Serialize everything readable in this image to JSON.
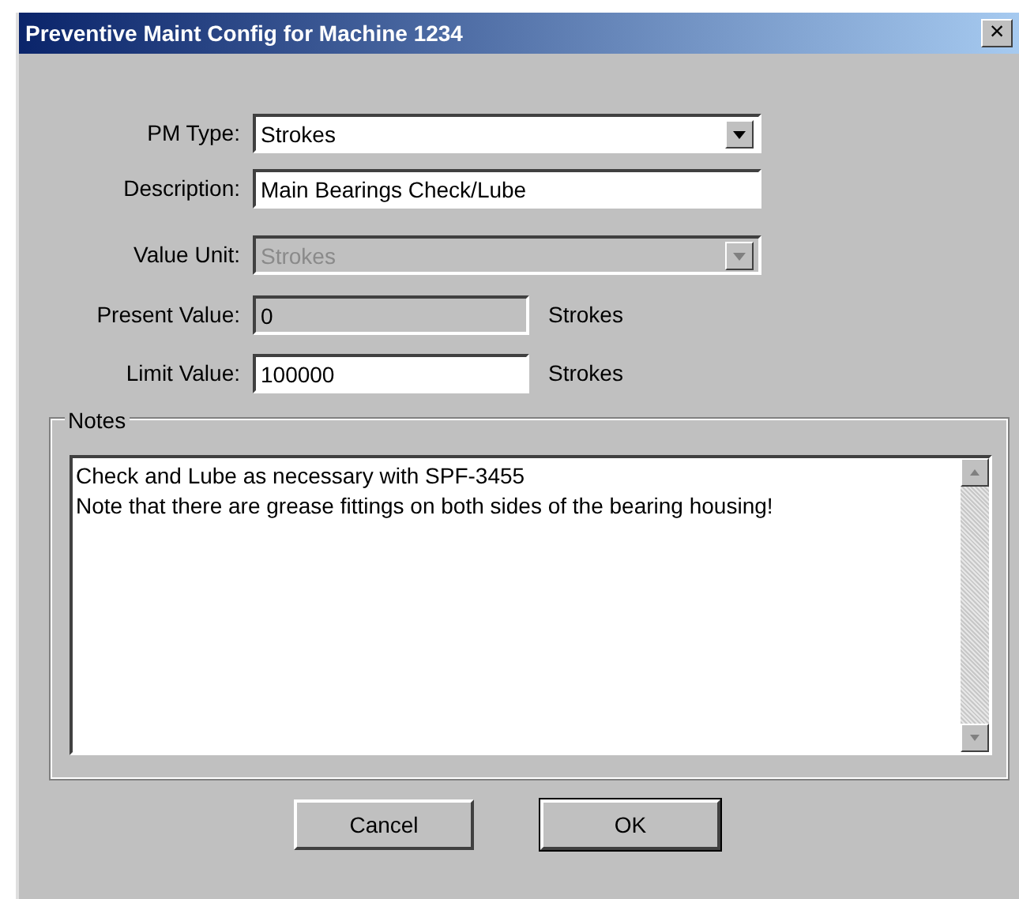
{
  "window": {
    "title": "Preventive Maint Config for Machine 1234",
    "close": "×"
  },
  "fields": [
    {
      "label": "PM Type:",
      "kind": "select",
      "value": "Strokes",
      "disabled": false,
      "readonly": false
    },
    {
      "label": "Description:",
      "kind": "text",
      "value": "Main Bearings Check/Lube",
      "disabled": false,
      "readonly": false
    },
    {
      "label": "Value Unit:",
      "kind": "select",
      "value": "Strokes",
      "disabled": true,
      "readonly": false
    },
    {
      "label": "Present Value:",
      "kind": "short",
      "value": "0",
      "unit": "Strokes",
      "disabled": false,
      "readonly": true
    },
    {
      "label": "Limit Value:",
      "kind": "short",
      "value": "100000",
      "unit": "Strokes",
      "disabled": false,
      "readonly": false
    }
  ],
  "notes": {
    "legend": "Notes",
    "value": "Check and Lube as necessary with SPF-3455\nNote that there are grease fittings on both sides of the bearing housing!"
  },
  "buttons": [
    {
      "label": "Cancel",
      "default": false
    },
    {
      "label": "OK",
      "default": true
    }
  ]
}
